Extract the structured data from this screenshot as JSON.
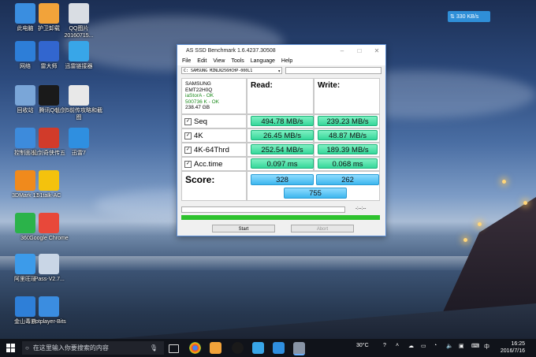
{
  "desktop_icons": [
    {
      "label": "此电脑",
      "color": "#3a8ee0"
    },
    {
      "label": "护卫卸载",
      "color": "#f2a33a"
    },
    {
      "label": "QQ图片20160715...",
      "color": "#d9dde3"
    },
    {
      "label": "网络",
      "color": "#2d7ed8"
    },
    {
      "label": "雷大师",
      "color": "#3266cf"
    },
    {
      "label": "迅雷链接器",
      "color": "#38a6e8"
    },
    {
      "label": "回收站",
      "color": "#7aa6d8"
    },
    {
      "label": "腾讯QQ",
      "color": "#1a1a1a"
    },
    {
      "label": "仙剑5前传攻略和截图",
      "color": "#e8e8e8"
    },
    {
      "label": "控制面板",
      "color": "#3d8bdc"
    },
    {
      "label": "仙剑奇侠传五",
      "color": "#d13b2a"
    },
    {
      "label": "迅雷7",
      "color": "#2f8fe0"
    },
    {
      "label": "3DMark 11",
      "color": "#f08a1c"
    },
    {
      "label": "51talk-AC",
      "color": "#f4c20d"
    },
    {
      "label": "360",
      "color": "#2bb34a"
    },
    {
      "label": "Google Chrome",
      "color": "#e8483a"
    },
    {
      "label": "阿里旺旺",
      "color": "#3c9bea"
    },
    {
      "label": "iPass-V2.7...",
      "color": "#c9d6e6"
    },
    {
      "label": "金山毒霸",
      "color": "#2e7fd8"
    },
    {
      "label": "Potplayer-Bits",
      "color": "#3b8de0"
    }
  ],
  "network_speed": "330 KB/s",
  "window": {
    "title": "AS SSD Benchmark 1.6.4237.30508",
    "menu": [
      "File",
      "Edit",
      "View",
      "Tools",
      "Language",
      "Help"
    ],
    "drive_selected": "C: SAMSUNG MZNLN256HCHP-000L1",
    "info": {
      "model": "SAMSUNG",
      "firmware": "EMT22H0Q",
      "driver": "iaStorA - OK",
      "alignment": "500736 K - OK",
      "size": "238.47 GB"
    },
    "read_header": "Read:",
    "write_header": "Write:",
    "rows": [
      {
        "label": "Seq",
        "read": "494.78 MB/s",
        "write": "239.23 MB/s"
      },
      {
        "label": "4K",
        "read": "26.45 MB/s",
        "write": "48.87 MB/s"
      },
      {
        "label": "4K-64Thrd",
        "read": "252.54 MB/s",
        "write": "189.39 MB/s"
      },
      {
        "label": "Acc.time",
        "read": "0.097 ms",
        "write": "0.068 ms"
      }
    ],
    "score_label": "Score:",
    "score_read": "328",
    "score_write": "262",
    "score_total": "755",
    "progress_text": "-:--:--",
    "progress_fraction": 1.0,
    "start_label": "Start",
    "abort_label": "Abort"
  },
  "taskbar": {
    "search_placeholder": "在这里输入你要搜索的内容",
    "temperature": "30°C",
    "time": "16:25",
    "date": "2016/7/16",
    "lang": "中"
  }
}
